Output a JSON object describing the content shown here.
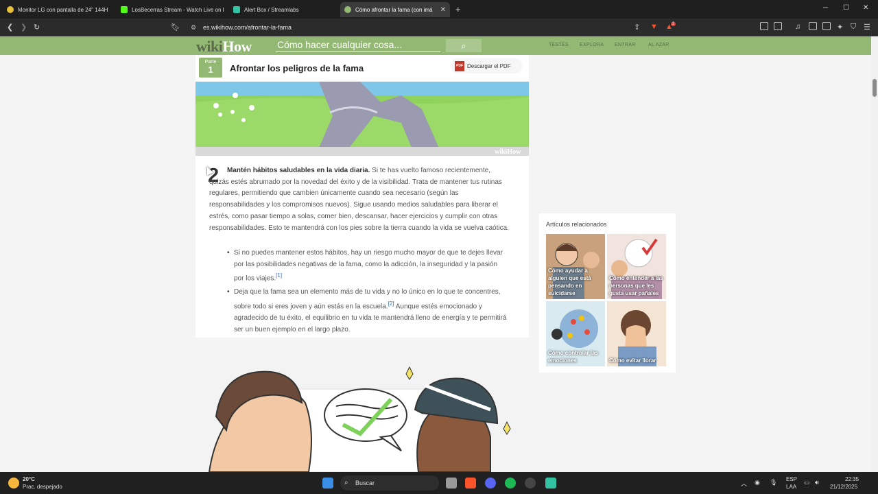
{
  "browser": {
    "tabs": [
      {
        "label": "Monitor LG con pantalla de 24\" 144H",
        "active": false
      },
      {
        "label": "LosBecerras Stream - Watch Live on K",
        "active": false
      },
      {
        "label": "Alert Box / Streamlabs",
        "active": false
      },
      {
        "label": "Cómo afrontar la fama (con imá",
        "active": true
      }
    ],
    "url": "es.wikihow.com/afrontar-la-fama",
    "brave_badge": "2"
  },
  "site": {
    "logo_wiki": "wiki",
    "logo_how": "How",
    "search_placeholder": "Cómo hacer cualquier cosa...",
    "nav": [
      "TESTES",
      "EXPLORA",
      "ENTRAR",
      "AL AZAR"
    ]
  },
  "section": {
    "part_label": "Parte",
    "part_number": "1",
    "title": "Afrontar los peligros de la fama",
    "pdf_label": "Descargar el PDF",
    "pdf_icon_text": "PDF",
    "watermark": "wikiHow"
  },
  "step": {
    "number": "2",
    "bold": "Mantén hábitos saludables en la vida diaria.",
    "text": " Si te has vuelto famoso recientemente, quizás estés abrumado por la novedad del éxito y de la visibilidad. Trata de mantener tus rutinas regulares, permitiendo que cambien únicamente cuando sea necesario (según las responsabilidades y los compromisos nuevos). Sigue usando medios saludables para liberar el estrés, como pasar tiempo a solas, comer bien, descansar, hacer ejercicios y cumplir con otras responsabilidades. Esto te mantendrá con los pies sobre la tierra cuando la vida se vuelva caótica.",
    "bullets": [
      {
        "text": "Si no puedes mantener estos hábitos, hay un riesgo mucho mayor de que te dejes llevar por las posibilidades negativas de la fama, como la adicción, la inseguridad y la pasión por los viajes.",
        "ref": "[1]",
        "after": ""
      },
      {
        "text": "Deja que la fama sea un elemento más de tu vida y no lo único en lo que te concentres, sobre todo si eres joven y aún estás en la escuela.",
        "ref": "[2]",
        "after": " Aunque estés emocionado y agradecido de tu éxito, el equilibrio en tu vida te mantendrá lleno de energía y te permitirá ser un buen ejemplo en el largo plazo."
      }
    ]
  },
  "related": {
    "title": "Artículos relacionados",
    "items": [
      {
        "caption": "Cómo ayudar a alguien que está pensando en suicidarse"
      },
      {
        "caption": "Cómo entender a las personas que les gusta usar pañales"
      },
      {
        "caption": "Cómo controlar las emociones"
      },
      {
        "caption": "Cómo evitar llorar"
      }
    ]
  },
  "taskbar": {
    "weather_temp": "20°C",
    "weather_desc": "Prac. despejado",
    "search_label": "Buscar",
    "lang_top": "ESP",
    "lang_bottom": "LAA",
    "time": "22:35",
    "date": "21/12/2025"
  },
  "colors": {
    "brand_green": "#93b873",
    "tab_bg": "#1f1f1f",
    "toolbar_bg": "#2b2b2b"
  }
}
